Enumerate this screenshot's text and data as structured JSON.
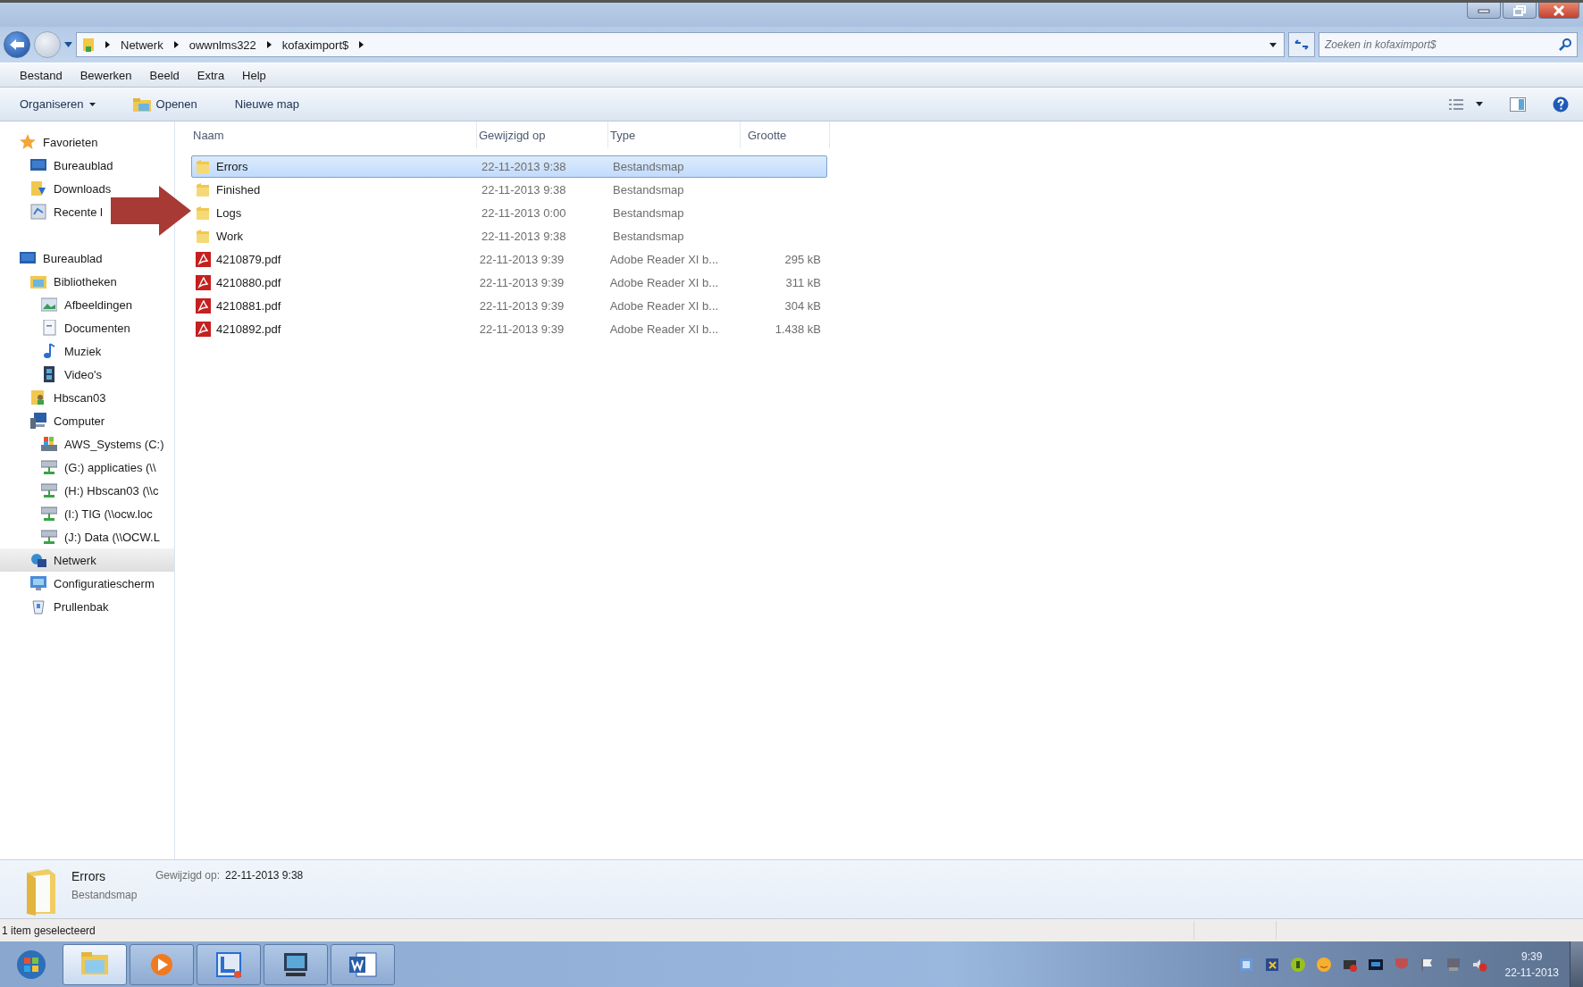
{
  "address": {
    "parts": [
      "Netwerk",
      "owwnlms322",
      "kofaximport$"
    ]
  },
  "search": {
    "placeholder": "Zoeken in kofaximport$"
  },
  "menu": [
    "Bestand",
    "Bewerken",
    "Beeld",
    "Extra",
    "Help"
  ],
  "toolbar": [
    {
      "label": "Organiseren",
      "kind": "dropdown"
    },
    {
      "label": "Openen",
      "kind": "open"
    },
    {
      "label": "Nieuwe map",
      "kind": "plain"
    }
  ],
  "sidebar": {
    "items": [
      {
        "label": "Favorieten",
        "kind": "star",
        "selected": false,
        "children": [
          {
            "label": "Bureaublad",
            "kind": "desktop",
            "selected": false
          },
          {
            "label": "Downloads",
            "kind": "downloads",
            "selected": false
          },
          {
            "label": "Recente l",
            "kind": "recent",
            "selected": false
          }
        ]
      },
      {
        "label": "Bureaublad",
        "kind": "desktop",
        "selected": false,
        "children": [
          {
            "label": "Bibliotheken",
            "kind": "library",
            "selected": false,
            "children": [
              {
                "label": "Afbeeldingen",
                "kind": "pictures",
                "selected": false
              },
              {
                "label": "Documenten",
                "kind": "documents",
                "selected": false
              },
              {
                "label": "Muziek",
                "kind": "music",
                "selected": false
              },
              {
                "label": "Video's",
                "kind": "video",
                "selected": false
              }
            ]
          },
          {
            "label": "Hbscan03",
            "kind": "user",
            "selected": false
          },
          {
            "label": "Computer",
            "kind": "computer",
            "selected": false,
            "children": [
              {
                "label": "AWS_Systems (C:)",
                "kind": "drive",
                "selected": false
              },
              {
                "label": "(G:) applicaties (\\\\",
                "kind": "netdrive",
                "selected": false
              },
              {
                "label": "(H:) Hbscan03 (\\\\c",
                "kind": "netdrive",
                "selected": false
              },
              {
                "label": "(I:) TIG (\\\\ocw.loc",
                "kind": "netdrive",
                "selected": false
              },
              {
                "label": "(J:) Data (\\\\OCW.L",
                "kind": "netdrive",
                "selected": false
              }
            ]
          },
          {
            "label": "Netwerk",
            "kind": "network",
            "selected": true
          },
          {
            "label": "Configuratiescherm",
            "kind": "control",
            "selected": false
          },
          {
            "label": "Prullenbak",
            "kind": "trash",
            "selected": false
          }
        ]
      }
    ]
  },
  "table": {
    "columns": [
      "Naam",
      "Gewijzigd op",
      "Type",
      "Grootte"
    ],
    "rows": [
      {
        "name": "Errors",
        "modified": "22-11-2013 9:38",
        "type": "Bestandsmap",
        "kind": "folder",
        "selected": true
      },
      {
        "name": "Finished",
        "modified": "22-11-2013 9:38",
        "type": "Bestandsmap",
        "kind": "folder",
        "selected": false
      },
      {
        "name": "Logs",
        "modified": "22-11-2013 0:00",
        "type": "Bestandsmap",
        "kind": "folder",
        "selected": false
      },
      {
        "name": "Work",
        "modified": "22-11-2013 9:38",
        "type": "Bestandsmap",
        "kind": "folder",
        "selected": false
      },
      {
        "name": "4210879.pdf",
        "modified": "22-11-2013 9:39",
        "type": "Adobe Reader XI b...",
        "size": "295 kB",
        "kind": "pdf",
        "selected": false
      },
      {
        "name": "4210880.pdf",
        "modified": "22-11-2013 9:39",
        "type": "Adobe Reader XI b...",
        "size": "311 kB",
        "kind": "pdf",
        "selected": false
      },
      {
        "name": "4210881.pdf",
        "modified": "22-11-2013 9:39",
        "type": "Adobe Reader XI b...",
        "size": "304 kB",
        "kind": "pdf",
        "selected": false
      },
      {
        "name": "4210892.pdf",
        "modified": "22-11-2013 9:39",
        "type": "Adobe Reader XI b...",
        "size": "1.438 kB",
        "kind": "pdf",
        "selected": false
      }
    ]
  },
  "details": {
    "name": "Errors",
    "type": "Bestandsmap",
    "modified_label": "Gewijzigd op:",
    "modified": "22-11-2013 9:38"
  },
  "status_bar": {
    "text": "1 item geselecteerd"
  },
  "taskbar": {
    "apps": [
      {
        "kind": "explorer",
        "selected": true
      },
      {
        "kind": "media",
        "selected": false
      },
      {
        "kind": "remote",
        "selected": false
      },
      {
        "kind": "monitor",
        "selected": false
      },
      {
        "kind": "word",
        "selected": false
      }
    ],
    "clock": {
      "time": "9:39",
      "date": "22-11-2013"
    }
  }
}
